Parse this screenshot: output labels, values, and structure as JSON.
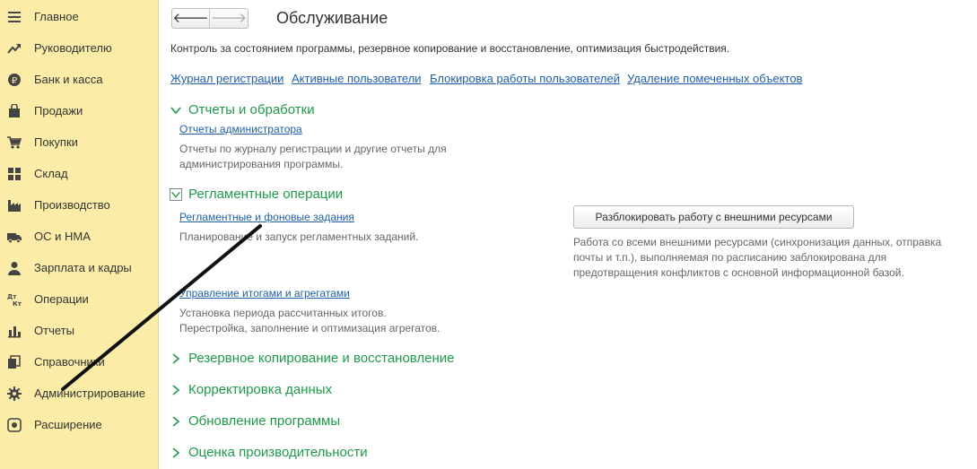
{
  "sidebar": {
    "items": [
      {
        "label": "Главное",
        "icon": "menu-icon"
      },
      {
        "label": "Руководителю",
        "icon": "trend-icon"
      },
      {
        "label": "Банк и касса",
        "icon": "ruble-coin-icon"
      },
      {
        "label": "Продажи",
        "icon": "shopping-bag-icon"
      },
      {
        "label": "Покупки",
        "icon": "cart-icon"
      },
      {
        "label": "Склад",
        "icon": "warehouse-grid-icon"
      },
      {
        "label": "Производство",
        "icon": "factory-icon"
      },
      {
        "label": "ОС и НМА",
        "icon": "truck-icon"
      },
      {
        "label": "Зарплата и кадры",
        "icon": "person-icon"
      },
      {
        "label": "Операции",
        "icon": "dt-kt-icon",
        "icon_text_top": "Дт",
        "icon_text_bottom": "Кт"
      },
      {
        "label": "Отчеты",
        "icon": "bar-chart-icon"
      },
      {
        "label": "Справочники",
        "icon": "books-icon"
      },
      {
        "label": "Администрирование",
        "icon": "gear-icon"
      },
      {
        "label": "Расширение",
        "icon": "extension-icon"
      }
    ]
  },
  "header": {
    "back_symbol": "🡐",
    "forward_symbol": "🡒",
    "title": "Обслуживание",
    "description": "Контроль за состоянием программы, резервное копирование и восстановление, оптимизация быстродействия."
  },
  "top_links": {
    "log": "Журнал регистрации",
    "active_users": "Активные пользователи",
    "block_users": "Блокировка работы пользователей",
    "delete_marked": "Удаление помеченных объектов"
  },
  "sections": {
    "reports": {
      "title": "Отчеты и обработки",
      "link": "Отчеты администратора",
      "description": "Отчеты по журналу регистрации и другие отчеты для администрирования программы."
    },
    "routine": {
      "title": "Регламентные операции",
      "link1": "Регламентные и фоновые задания",
      "desc1": "Планирование и запуск регламентных заданий.",
      "link2": "Управление итогами и агрегатами",
      "desc2_line1": "Установка периода рассчитанных итогов.",
      "desc2_line2": "Перестройка, заполнение и оптимизация агрегатов.",
      "unlock_button": "Разблокировать работу с внешними ресурсами",
      "unlock_description": "Работа со всеми внешними ресурсами (синхронизация данных, отправка почты и т.п.), выполняемая по расписанию заблокирована для предотвращения конфликтов с основной информационной базой."
    },
    "backup": {
      "title": "Резервное копирование и восстановление"
    },
    "correction": {
      "title": "Корректировка данных"
    },
    "update": {
      "title": "Обновление программы"
    },
    "performance": {
      "title": "Оценка производительности"
    }
  },
  "colors": {
    "sidebar_bg": "#fbeda8",
    "link": "#1f5fa5",
    "section_title": "#1f9a4c",
    "annotation": "#111111"
  }
}
